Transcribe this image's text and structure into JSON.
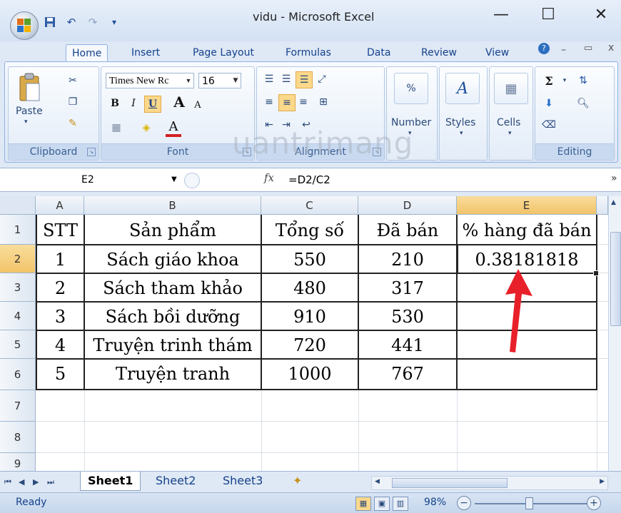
{
  "window": {
    "title": "vidu - Microsoft Excel",
    "minimize_glyph": "—",
    "maximize_glyph": "☐",
    "close_glyph": "✕"
  },
  "qat": {
    "save_icon": "save-icon",
    "undo_icon": "undo-icon",
    "redo_icon": "redo-icon",
    "customize_glyph": "₹"
  },
  "tabs": [
    "Home",
    "Insert",
    "Page Layout",
    "Formulas",
    "Data",
    "Review",
    "View"
  ],
  "ribbon": {
    "clipboard": {
      "label": "Clipboard",
      "paste": "Paste"
    },
    "font": {
      "label": "Font",
      "name": "Times New Rc",
      "size": "16",
      "bold": "B",
      "italic": "I",
      "underline": "U",
      "grow": "A",
      "shrink": "A",
      "color_letter": "A"
    },
    "alignment": {
      "label": "Alignment"
    },
    "number": {
      "label": "Number",
      "percent": "%"
    },
    "styles": {
      "label": "Styles"
    },
    "cells": {
      "label": "Cells"
    },
    "editing": {
      "label": "Editing",
      "sum": "Σ"
    }
  },
  "formula_bar": {
    "name_box": "E2",
    "fx": "fx",
    "formula": "=D2/C2"
  },
  "columns": [
    "A",
    "B",
    "C",
    "D",
    "E"
  ],
  "rows": [
    "1",
    "2",
    "3",
    "4",
    "5",
    "6",
    "7",
    "8",
    "9"
  ],
  "table": {
    "header": [
      "STT",
      "Sản phẩm",
      "Tổng số",
      "Đã bán",
      "% hàng đã bán"
    ],
    "rows": [
      [
        "1",
        "Sách giáo khoa",
        "550",
        "210",
        "0.38181818"
      ],
      [
        "2",
        "Sách tham khảo",
        "480",
        "317",
        ""
      ],
      [
        "3",
        "Sách bồi dưỡng",
        "910",
        "530",
        ""
      ],
      [
        "4",
        "Truyện trinh thám",
        "720",
        "441",
        ""
      ],
      [
        "5",
        "Truyện tranh",
        "1000",
        "767",
        ""
      ]
    ]
  },
  "sheets": [
    "Sheet1",
    "Sheet2",
    "Sheet3"
  ],
  "status": {
    "text": "Ready",
    "zoom": "98%"
  },
  "watermark": "uantrimang",
  "colors": {
    "accent_blue": "#15428b",
    "arrow_red": "#e8202a",
    "selection_orange": "#f2c46a"
  }
}
